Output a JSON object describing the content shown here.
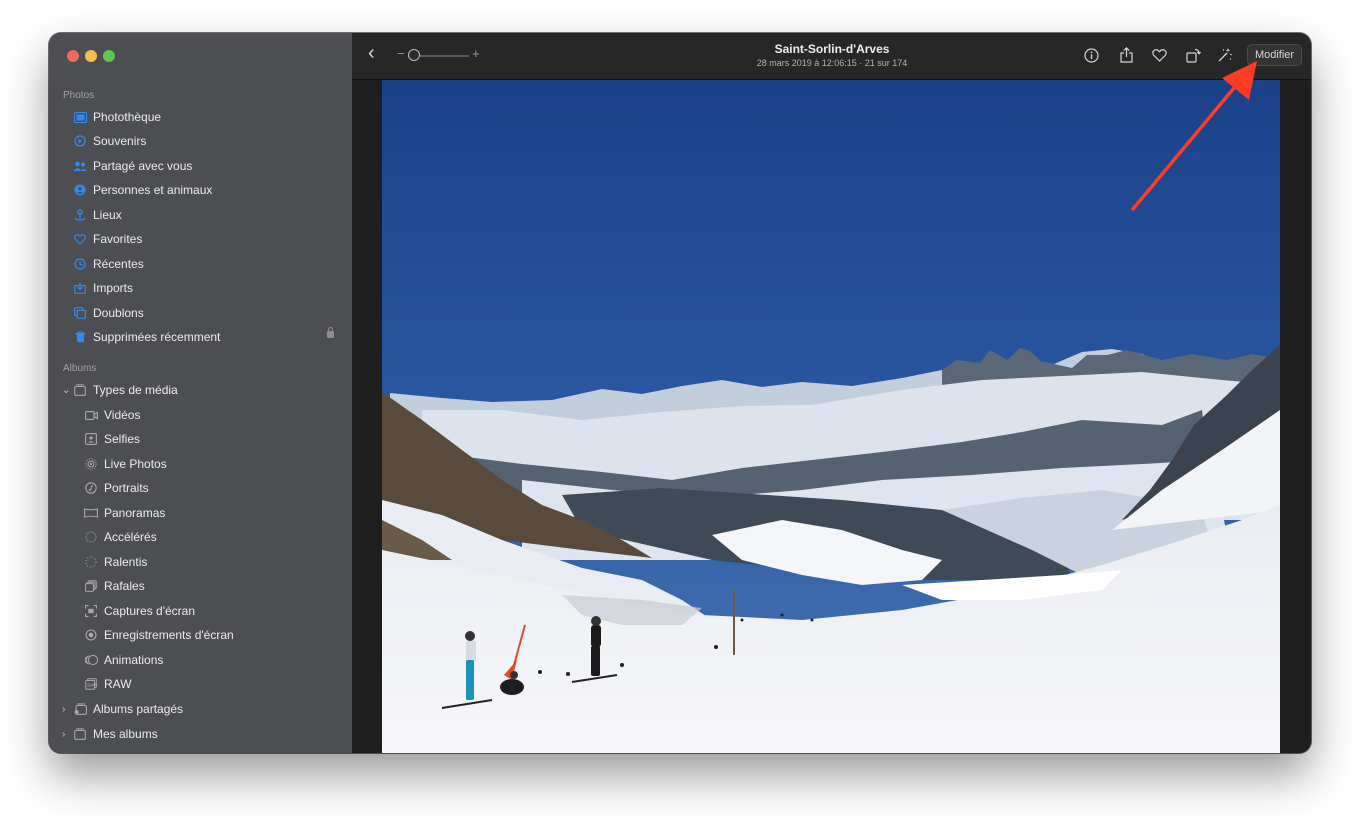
{
  "window": {
    "controls": [
      "close",
      "minimize",
      "zoom"
    ]
  },
  "sidebar": {
    "photos_section": "Photos",
    "photos_items": [
      {
        "label": "Photothèque",
        "icon": "photo-library-icon"
      },
      {
        "label": "Souvenirs",
        "icon": "memories-icon"
      },
      {
        "label": "Partagé avec vous",
        "icon": "shared-with-you-icon"
      },
      {
        "label": "Personnes et animaux",
        "icon": "people-icon"
      },
      {
        "label": "Lieux",
        "icon": "places-icon"
      },
      {
        "label": "Favorites",
        "icon": "heart-icon"
      },
      {
        "label": "Récentes",
        "icon": "clock-icon"
      },
      {
        "label": "Imports",
        "icon": "import-icon"
      },
      {
        "label": "Doublons",
        "icon": "duplicates-icon"
      },
      {
        "label": "Supprimées récemment",
        "icon": "trash-icon",
        "locked": true
      }
    ],
    "albums_section": "Albums",
    "media_types": {
      "label": "Types de média",
      "icon": "media-types-icon",
      "expanded": true,
      "items": [
        {
          "label": "Vidéos",
          "icon": "video-icon"
        },
        {
          "label": "Selfies",
          "icon": "selfie-icon"
        },
        {
          "label": "Live Photos",
          "icon": "live-photo-icon"
        },
        {
          "label": "Portraits",
          "icon": "portrait-icon"
        },
        {
          "label": "Panoramas",
          "icon": "panorama-icon"
        },
        {
          "label": "Accélérés",
          "icon": "timelapse-icon"
        },
        {
          "label": "Ralentis",
          "icon": "slow-motion-icon"
        },
        {
          "label": "Rafales",
          "icon": "burst-icon"
        },
        {
          "label": "Captures d'écran",
          "icon": "screenshot-icon"
        },
        {
          "label": "Enregistrements d'écran",
          "icon": "screen-recording-icon"
        },
        {
          "label": "Animations",
          "icon": "animation-icon"
        },
        {
          "label": "RAW",
          "icon": "raw-icon"
        }
      ]
    },
    "shared_albums": {
      "label": "Albums partagés",
      "icon": "shared-album-icon",
      "expanded": false
    },
    "my_albums": {
      "label": "Mes albums",
      "icon": "album-icon",
      "expanded": false
    }
  },
  "toolbar": {
    "zoom_minus": "−",
    "zoom_plus": "+",
    "zoom_level": 0,
    "title": "Saint-Sorlin-d'Arves",
    "subtitle": "28 mars 2019 à 12:06:15  ·  21 sur 174",
    "icons": [
      "info-icon",
      "share-icon",
      "heart-icon",
      "rotate-icon",
      "auto-enhance-icon"
    ],
    "edit_label": "Modifier"
  },
  "colors": {
    "sidebar_bg": "#4d4e52",
    "accent": "#2f8bf3",
    "annotation_arrow": "#ff3b26"
  }
}
